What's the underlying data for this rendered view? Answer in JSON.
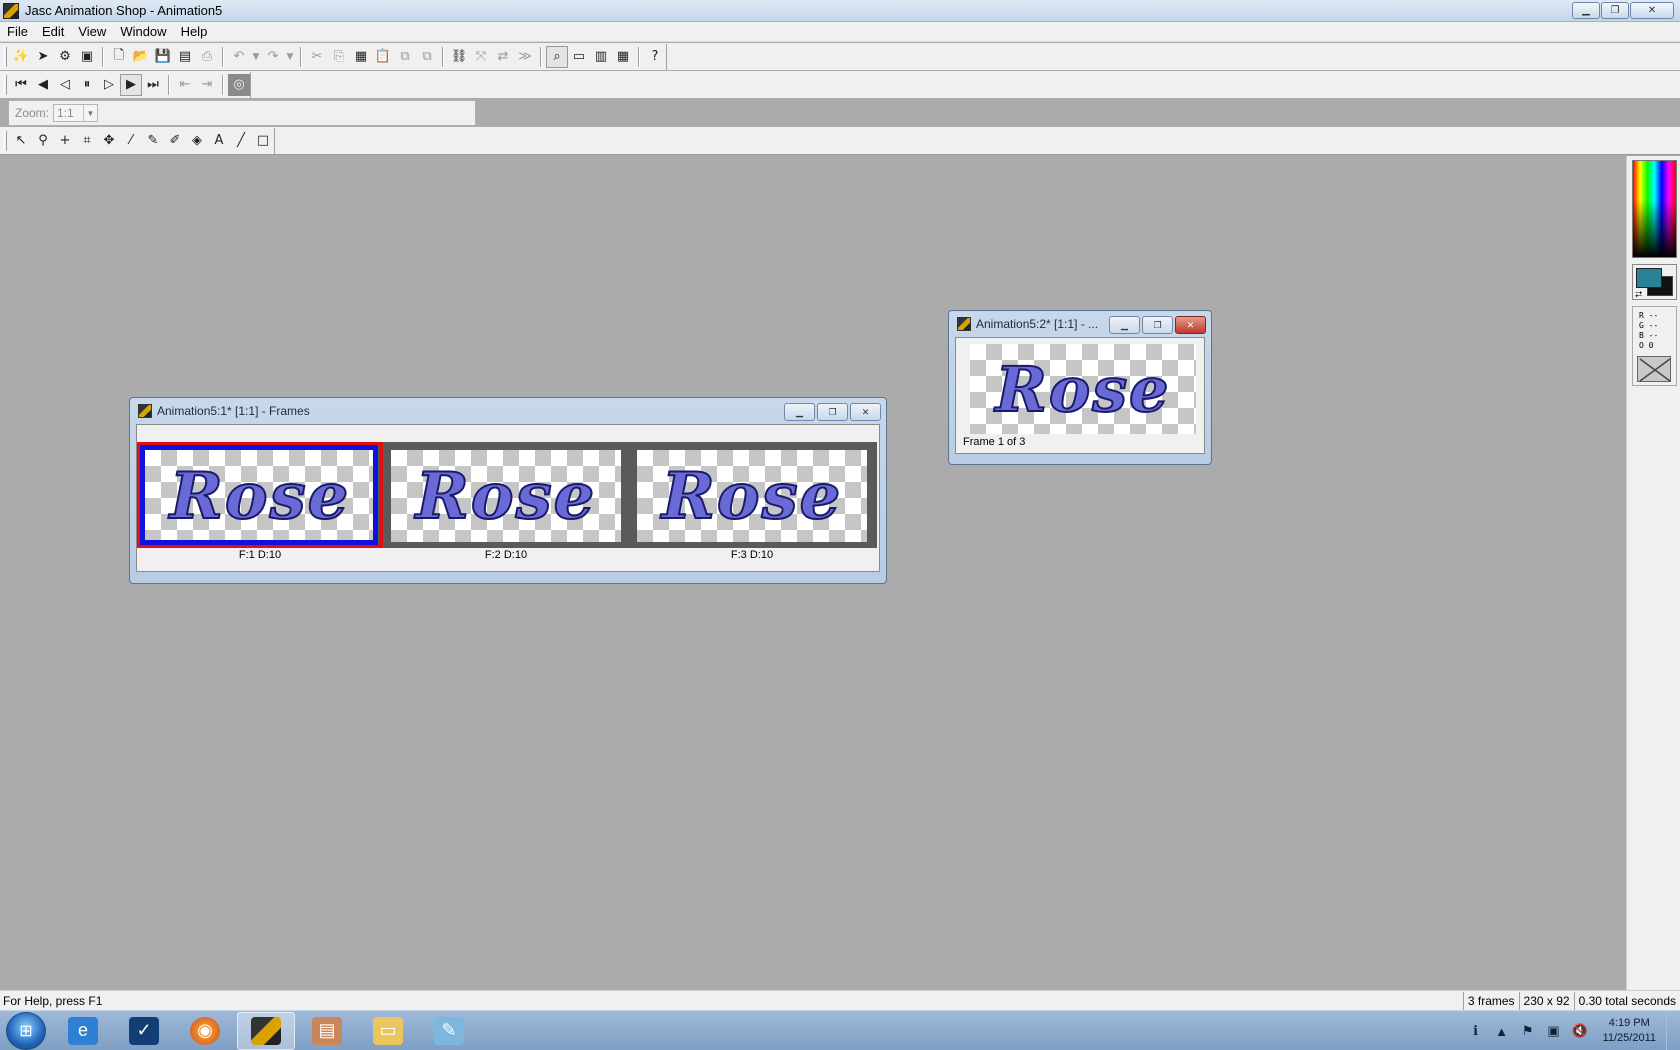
{
  "window": {
    "title": "Jasc Animation Shop - Animation5",
    "controls": {
      "minimize": "▁",
      "restore": "❐",
      "close": "✕"
    }
  },
  "menu": [
    "File",
    "Edit",
    "View",
    "Window",
    "Help"
  ],
  "toolbar": {
    "zoom_label": "Zoom:",
    "zoom_value": "1:1"
  },
  "frames_window": {
    "title": "Animation5:1* [1:1] - Frames",
    "image_text": "Rose",
    "frames": [
      {
        "label": "F:1   D:10",
        "selected": true
      },
      {
        "label": "F:2   D:10",
        "selected": false
      },
      {
        "label": "F:3   D:10",
        "selected": false
      }
    ]
  },
  "preview_window": {
    "title": "Animation5:2* [1:1] - ...",
    "image_text": "Rose",
    "caption": "Frame 1 of 3"
  },
  "palette": {
    "foreground": "#2a8296",
    "background": "#111111",
    "r": "R --",
    "g": "G --",
    "b": "B --",
    "o": "O 0"
  },
  "status": {
    "help": "For Help, press F1",
    "frames": "3 frames",
    "size": "230 x 92",
    "time": "0.30 total seconds"
  },
  "taskbar": {
    "time": "4:19 PM",
    "date": "11/25/2011"
  },
  "colors": {
    "selection_outer": "#e01010",
    "selection_inner": "#1010e0",
    "rose_fill": "#6a6ad6"
  }
}
